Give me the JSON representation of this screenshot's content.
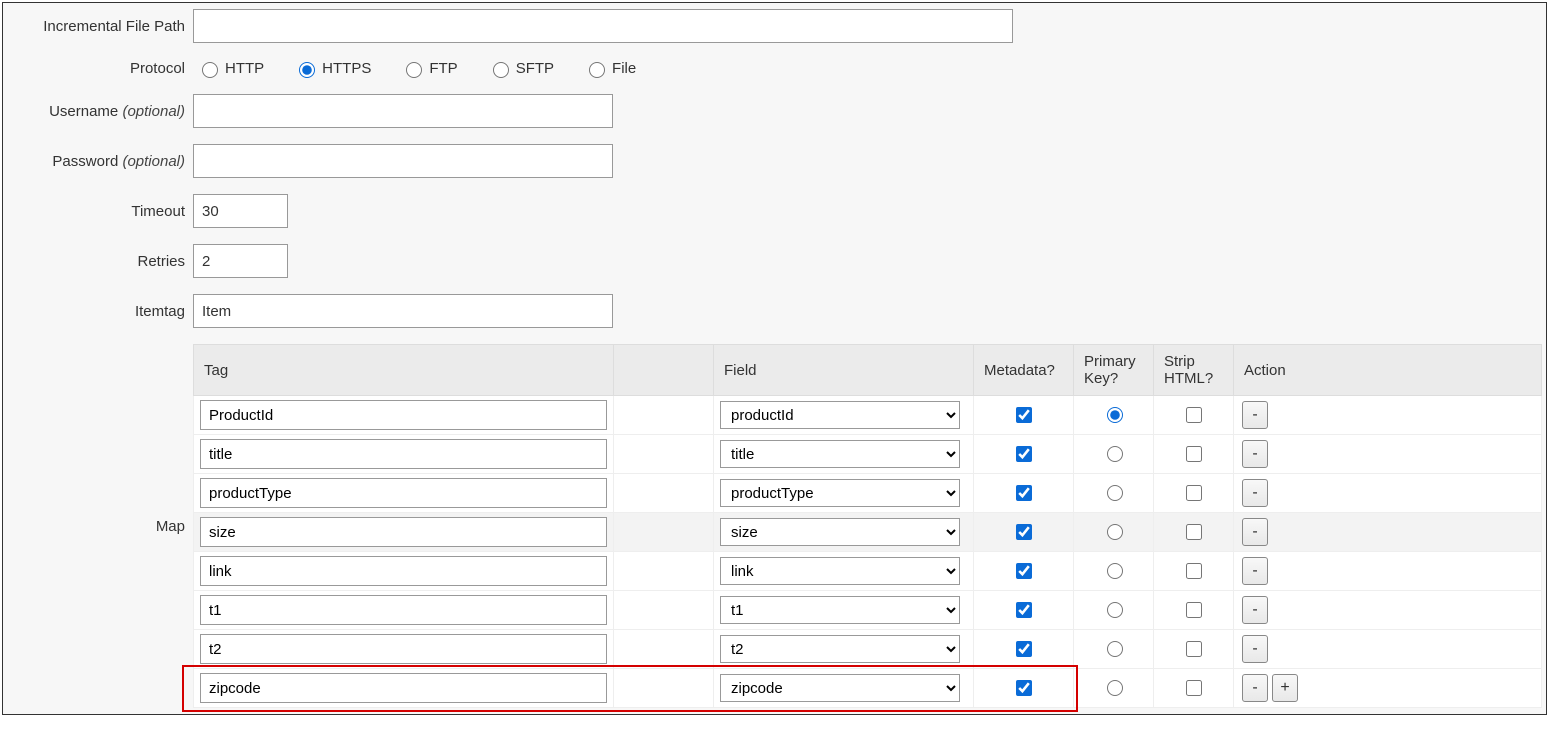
{
  "labels": {
    "incremental_file_path": "Incremental File Path",
    "protocol": "Protocol",
    "username": "Username",
    "password": "Password",
    "optional": "(optional)",
    "timeout": "Timeout",
    "retries": "Retries",
    "itemtag": "Itemtag",
    "map": "Map"
  },
  "values": {
    "incremental_file_path": "",
    "username": "",
    "password": "",
    "timeout": "30",
    "retries": "2",
    "itemtag": "Item"
  },
  "protocol": {
    "options": [
      "HTTP",
      "HTTPS",
      "FTP",
      "SFTP",
      "File"
    ],
    "selected": "HTTPS"
  },
  "map_table": {
    "headers": {
      "tag": "Tag",
      "field": "Field",
      "metadata": "Metadata?",
      "primary_key": "Primary Key?",
      "strip_html": "Strip HTML?",
      "action": "Action"
    },
    "buttons": {
      "remove": "-",
      "add": "+"
    },
    "rows": [
      {
        "tag": "ProductId",
        "field": "productId",
        "metadata": true,
        "primary_key": true,
        "strip_html": false
      },
      {
        "tag": "title",
        "field": "title",
        "metadata": true,
        "primary_key": false,
        "strip_html": false
      },
      {
        "tag": "productType",
        "field": "productType",
        "metadata": true,
        "primary_key": false,
        "strip_html": false
      },
      {
        "tag": "size",
        "field": "size",
        "metadata": true,
        "primary_key": false,
        "strip_html": false
      },
      {
        "tag": "link",
        "field": "link",
        "metadata": true,
        "primary_key": false,
        "strip_html": false
      },
      {
        "tag": "t1",
        "field": "t1",
        "metadata": true,
        "primary_key": false,
        "strip_html": false
      },
      {
        "tag": "t2",
        "field": "t2",
        "metadata": true,
        "primary_key": false,
        "strip_html": false
      },
      {
        "tag": "zipcode",
        "field": "zipcode",
        "metadata": true,
        "primary_key": false,
        "strip_html": false
      }
    ],
    "highlighted_row_index": 3,
    "red_box_row_index": 7
  }
}
